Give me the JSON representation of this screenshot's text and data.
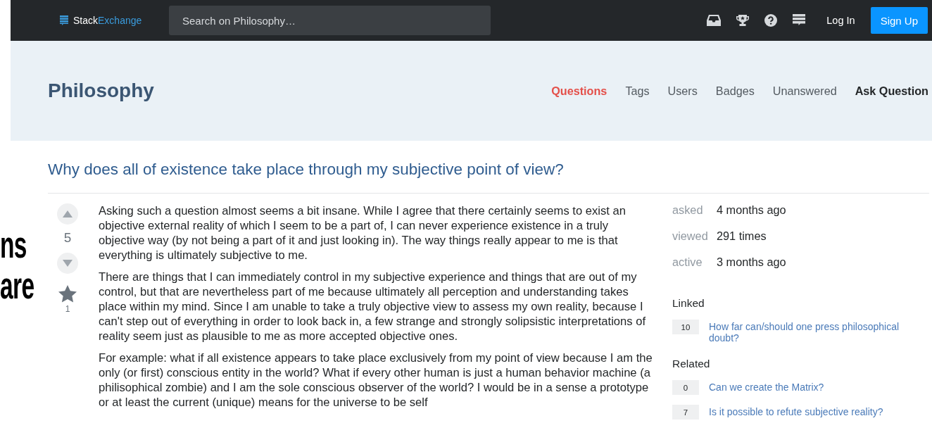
{
  "top_bar": {
    "logo": {
      "part_1": "Stack",
      "part_2": "Exchange"
    },
    "search": {
      "placeholder": "Search on Philosophy…"
    },
    "login": "Log In",
    "signup": "Sign Up"
  },
  "site_header": {
    "site_name": "Philosophy",
    "nav": [
      {
        "label": "Questions",
        "selected": true
      },
      {
        "label": "Tags",
        "selected": false
      },
      {
        "label": "Users",
        "selected": false
      },
      {
        "label": "Badges",
        "selected": false
      },
      {
        "label": "Unanswered",
        "selected": false
      }
    ],
    "ask_button": "Ask Question"
  },
  "question": {
    "title": "Why does all of existence take place through my subjective point of view?",
    "score": "5",
    "favorite_count": "1",
    "paragraphs": [
      "Asking such a question almost seems a bit insane. While I agree that there certainly seems to exist an objective external reality of which I seem to be a part of, I can never experience existence in a truly objective way (by not being a part of it and just looking in). The way things really appear to me is that everything is ultimately subjective to me.",
      "There are things that I can immediately control in my subjective experience and things that are out of my control, but that are nevertheless part of me because ultimately all perception and understanding takes place within my mind. Since I am unable to take a truly objective view to assess my own reality, because I can't step out of everything in order to look back in, a few strange and strongly solipsistic interpretations of reality seem just as plausible to me as more accepted objective ones.",
      "For example: what if all existence appears to take place exclusively from my point of view because I am the only (or first) conscious entity in the world? What if every other human is just a human behavior machine (a philisophical zombie) and I am the sole conscious observer of the world? I would be in a sense a prototype or at least the current (unique) means for the universe to be self"
    ]
  },
  "sidebar": {
    "stats": [
      {
        "label": "asked",
        "value": "4 months ago"
      },
      {
        "label": "viewed",
        "value": "291 times"
      },
      {
        "label": "active",
        "value": "3 months ago"
      }
    ],
    "sections": [
      {
        "heading": "Linked",
        "items": [
          {
            "count": "10",
            "title": "How far can/should one press philosophical doubt?"
          }
        ]
      },
      {
        "heading": "Related",
        "items": [
          {
            "count": "0",
            "title": "Can we create the Matrix?"
          },
          {
            "count": "7",
            "title": "Is it possible to refute subjective reality?"
          }
        ]
      }
    ]
  },
  "overlay_caption": [
    "ns",
    "are"
  ]
}
